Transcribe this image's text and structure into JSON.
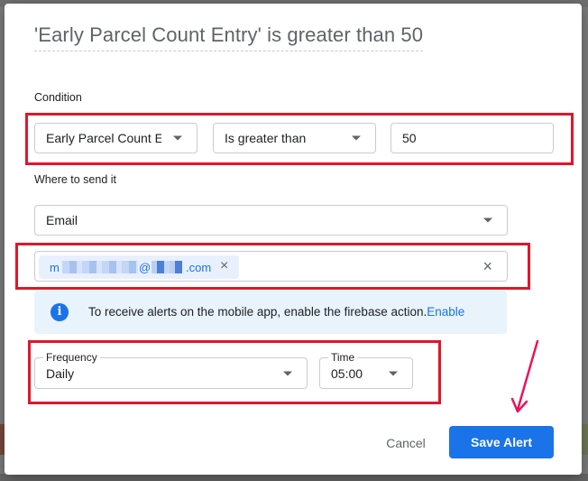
{
  "dialog": {
    "title": "'Early Parcel Count Entry' is greater than 50"
  },
  "condition": {
    "label": "Condition",
    "field_value": "Early Parcel Count E",
    "operator_value": "Is greater than",
    "threshold_value": "50"
  },
  "destination": {
    "label": "Where to send it",
    "channel_value": "Email",
    "recipient_chip": {
      "prefix": "m",
      "middle": "@",
      "suffix": ".com",
      "remove_symbol": "×"
    },
    "clear_symbol": "×"
  },
  "info": {
    "icon": "i",
    "message": "To receive alerts on the mobile app, enable the firebase action.",
    "link_text": "Enable"
  },
  "schedule": {
    "frequency_label": "Frequency",
    "frequency_value": "Daily",
    "time_label": "Time",
    "time_value": "05:00"
  },
  "actions": {
    "cancel_label": "Cancel",
    "save_label": "Save Alert"
  },
  "colors": {
    "accent": "#1a73e8",
    "highlight_box": "#e0162b",
    "arrow": "#e8155b"
  }
}
